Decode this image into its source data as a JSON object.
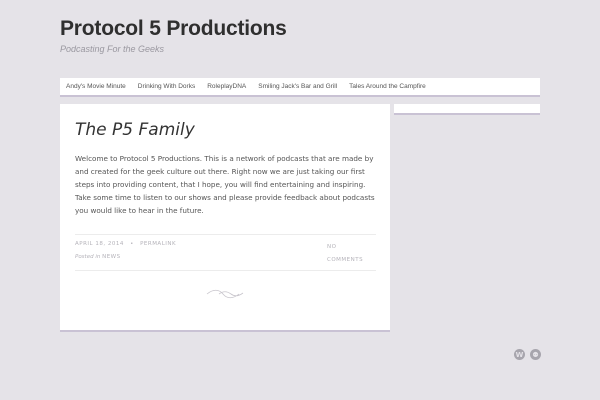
{
  "site": {
    "title": "Protocol 5 Productions",
    "description": "Podcasting For the Geeks"
  },
  "nav": {
    "items": [
      {
        "label": "Andy's Movie Minute"
      },
      {
        "label": "Drinking With Dorks"
      },
      {
        "label": "RoleplayDNA"
      },
      {
        "label": "Smiling Jack's Bar and Grill"
      },
      {
        "label": "Tales Around the Campfire"
      }
    ]
  },
  "post": {
    "title": "The P5 Family",
    "content": "Welcome to Protocol 5 Productions. This is a network of podcasts that are made by and created for the geek culture out there. Right now we are just taking our first steps into providing content, that I hope, you will find entertaining and inspiring. Take some time to listen to our shows and please provide feedback about podcasts you would like to hear in the future.",
    "date": "April 18, 2014",
    "separator": "•",
    "permalink": "Permalink",
    "posted_in": "Posted in",
    "category": "News",
    "comments_line1": "No",
    "comments_line2": "Comments"
  },
  "footer": {
    "icons": [
      {
        "name": "wordpress-icon",
        "glyph": "W"
      },
      {
        "name": "theme-icon",
        "glyph": "⚉"
      }
    ]
  },
  "colors": {
    "background": "#e5e3e8",
    "accent_border": "#c9c2d4",
    "title": "#2f2f2f",
    "muted": "#b5b3ba"
  }
}
